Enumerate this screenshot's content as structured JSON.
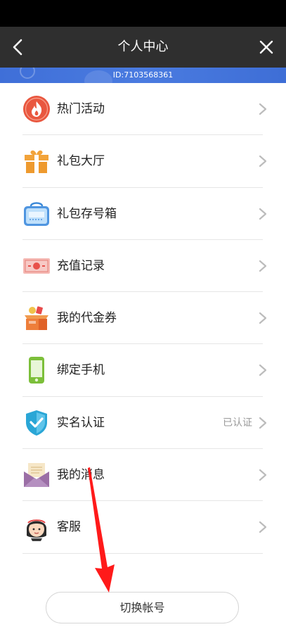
{
  "header": {
    "title": "个人中心",
    "user_id": "ID:7103568361"
  },
  "menu": {
    "items": [
      {
        "label": "热门活动",
        "icon": "fire-icon"
      },
      {
        "label": "礼包大厅",
        "icon": "gift-icon"
      },
      {
        "label": "礼包存号箱",
        "icon": "gift-box-storage-icon"
      },
      {
        "label": "充值记录",
        "icon": "recharge-record-icon"
      },
      {
        "label": "我的代金券",
        "icon": "voucher-box-icon"
      },
      {
        "label": "绑定手机",
        "icon": "phone-icon"
      },
      {
        "label": "实名认证",
        "icon": "shield-check-icon",
        "extra": "已认证"
      },
      {
        "label": "我的消息",
        "icon": "envelope-icon"
      },
      {
        "label": "客服",
        "icon": "customer-service-icon"
      }
    ]
  },
  "footer": {
    "switch_account_label": "切换帐号"
  },
  "colors": {
    "title_bar": "#2f2f2f",
    "id_strip": "#4a7be0",
    "annotation_arrow": "#ff1a1a"
  }
}
